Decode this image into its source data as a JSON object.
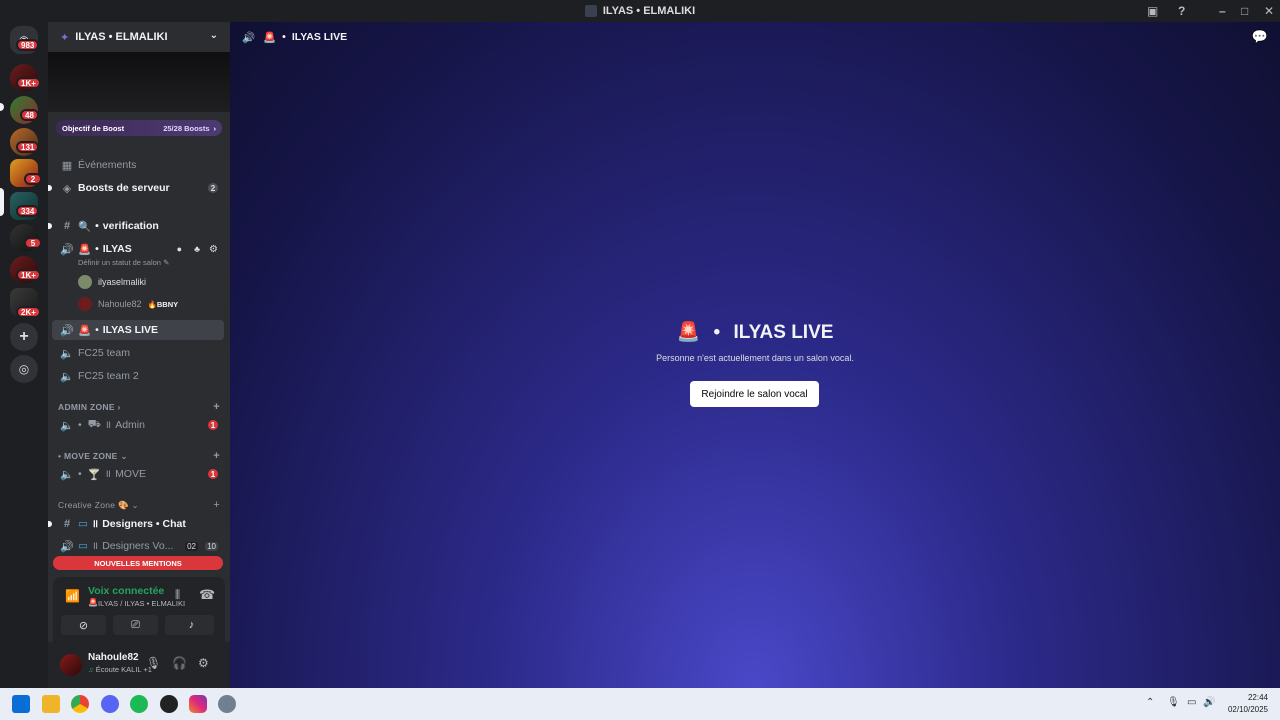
{
  "window": {
    "title": "ILYAS • ELMALIKI"
  },
  "rail": {
    "badges": [
      "983",
      "1K+",
      "48",
      "131",
      "2",
      "334",
      "5",
      "1K+",
      "2K+"
    ]
  },
  "sidebar": {
    "server_name": "ILYAS • ELMALIKI",
    "boost": {
      "label": "Objectif de Boost",
      "progress": "25/28 Boosts"
    },
    "events_label": "Événements",
    "boosts_label": "Boosts de serveur",
    "boosts_count": "2",
    "channels": {
      "verification": "verification",
      "ilyas_voice": "ILYAS",
      "ilyas_status": "Définir un statut de salon",
      "member1": "ilyaselmaliki",
      "member2": "Nahoule82",
      "member2_tag": "BBNY",
      "ilyas_live": "ILYAS LIVE",
      "fc25": "FC25 team",
      "fc25_2": "FC25 team 2",
      "admin_zone": "ADMIN ZONE",
      "admin": "Admin",
      "admin_count": "1",
      "move_zone": "MOVE ZONE",
      "move": "MOVE",
      "move_count": "1",
      "creative_zone": "Creative Zone",
      "designers_chat": "Designers • Chat",
      "designers_voice": "Designers Vo...",
      "designers_voice_count1": "02",
      "designers_voice_count2": "10"
    },
    "new_mentions": "NOUVELLES MENTIONS",
    "voice": {
      "status": "Voix connectée",
      "channel": "ILYAS / ILYAS • ELMALIKI"
    },
    "user": {
      "name": "Nahoule82",
      "status": "Écoute KALIL",
      "extra": "+1"
    }
  },
  "main": {
    "channel_title": "ILYAS LIVE",
    "heading": "ILYAS LIVE",
    "subtext": "Personne n'est actuellement dans un salon vocal.",
    "join_button": "Rejoindre le salon vocal"
  },
  "taskbar": {
    "time": "22:44",
    "date": "02/10/2025"
  },
  "colors": {
    "accent": "#5865f2",
    "online": "#23a55a",
    "mention": "#da373c"
  }
}
